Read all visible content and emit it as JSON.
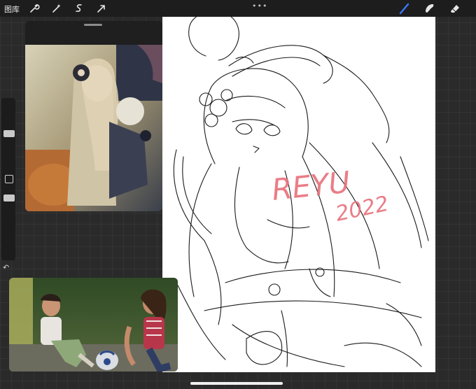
{
  "toolbar": {
    "gallery_label": "图库",
    "tools": [
      "wrench-icon",
      "magic-wand-icon",
      "selection-s-icon",
      "transform-arrow-icon"
    ],
    "more_dots": "•••",
    "right_tools": [
      "brush-icon",
      "smudge-icon",
      "eraser-icon"
    ],
    "active_tool_color": "#3b78ff"
  },
  "sidebar": {
    "undo_glyph": "↶"
  },
  "canvas": {
    "watermark_text": "REYU",
    "watermark_year": "2022",
    "watermark_color": "#e8707a"
  }
}
